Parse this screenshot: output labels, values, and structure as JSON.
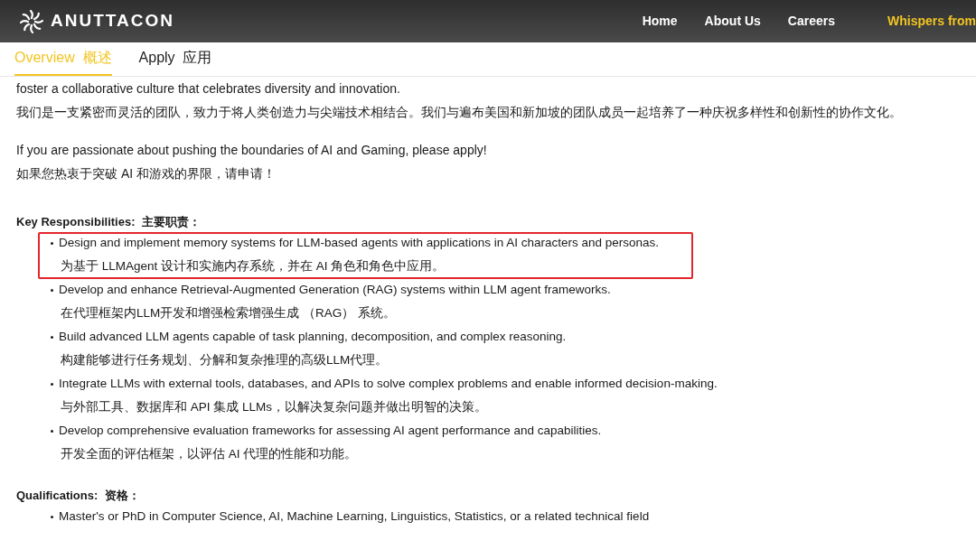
{
  "header": {
    "logo": "ANUTTACON",
    "nav": [
      {
        "label": "Home",
        "highlighted": false
      },
      {
        "label": "About Us",
        "highlighted": false
      },
      {
        "label": "Careers",
        "highlighted": false
      },
      {
        "label": "Whispers from",
        "highlighted": true
      }
    ]
  },
  "tabs": [
    {
      "label": "Overview  概述",
      "selected": true
    },
    {
      "label": "Apply  应用",
      "selected": false
    }
  ],
  "intro": [
    "foster a collaborative culture that celebrates diversity and innovation.",
    "我们是一支紧密而灵活的团队，致力于将人类创造力与尖端技术相结合。我们与遍布美国和新加坡的团队成员一起培养了一种庆祝多样性和创新性的协作文化。"
  ],
  "call": [
    "If you are passionate about pushing the boundaries of AI and Gaming, please apply!",
    "如果您热衷于突破 AI 和游戏的界限，请申请！"
  ],
  "sections": [
    {
      "heading": "Key Responsibilities:  主要职责：",
      "items": [
        {
          "en": "Design and implement memory systems for LLM-based agents with applications in AI characters and personas.",
          "zh": "为基于 LLMAgent 设计和实施内存系统，并在 AI 角色和角色中应用。",
          "highlighted": true
        },
        {
          "en": "Develop and enhance Retrieval-Augmented Generation (RAG) systems within LLM agent frameworks.",
          "zh": "在代理框架内LLM开发和增强检索增强生成 （RAG） 系统。",
          "highlighted": false
        },
        {
          "en": "Build advanced LLM agents capable of task planning, decomposition, and complex reasoning.",
          "zh": "构建能够进行任务规划、分解和复杂推理的高级LLM代理。",
          "highlighted": false
        },
        {
          "en": "Integrate LLMs with external tools, databases, and APIs to solve complex problems and enable informed decision-making.",
          "zh": "与外部工具、数据库和 API 集成 LLMs，以解决复杂问题并做出明智的决策。",
          "highlighted": false
        },
        {
          "en": "Develop comprehensive evaluation frameworks for assessing AI agent performance and capabilities.",
          "zh": "开发全面的评估框架，以评估 AI 代理的性能和功能。",
          "highlighted": false
        }
      ]
    },
    {
      "heading": "Qualifications:  资格：",
      "items": [
        {
          "en": "Master's or PhD in Computer Science, AI, Machine Learning, Linguistics, Statistics, or a related technical field",
          "highlighted": false
        }
      ]
    }
  ]
}
